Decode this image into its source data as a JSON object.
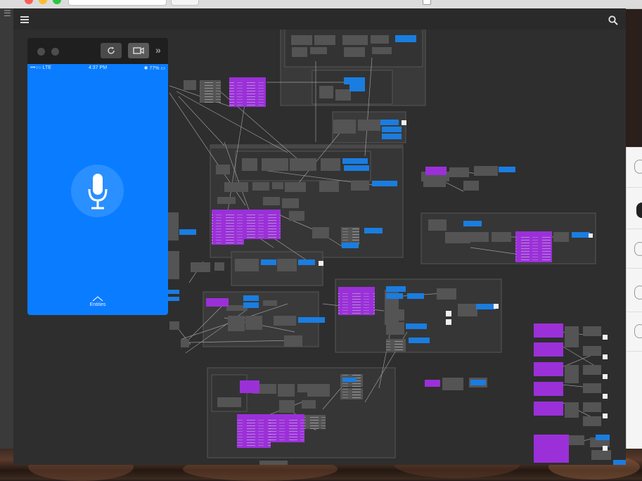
{
  "mac": {
    "traffic_lights": [
      "close",
      "minimize",
      "zoom"
    ],
    "colors": {
      "close": "#fc5f57",
      "minimize": "#fdbc2e",
      "zoom": "#29c840"
    }
  },
  "app": {
    "header": {
      "menu_icon": "hamburger-icon",
      "search_icon": "search-icon"
    },
    "colors": {
      "canvas": "#2e2e2e",
      "node": "#545454",
      "container": "#3a3a3a",
      "purple": "#9b30d9",
      "blue": "#1a7de0",
      "wire": "#bdbdbd"
    }
  },
  "viewer": {
    "buttons": [
      {
        "name": "refresh-button",
        "icon": "refresh-icon"
      },
      {
        "name": "video-record-button",
        "icon": "video-icon"
      }
    ],
    "more_glyph": "»",
    "status_bar": {
      "carrier": "•••○○ LTE",
      "time": "4:37 PM",
      "battery": "✱ 77% ▭"
    },
    "main_icon": "microphone-icon",
    "bottom_label": "Entities",
    "accent": "#0a7cff"
  }
}
